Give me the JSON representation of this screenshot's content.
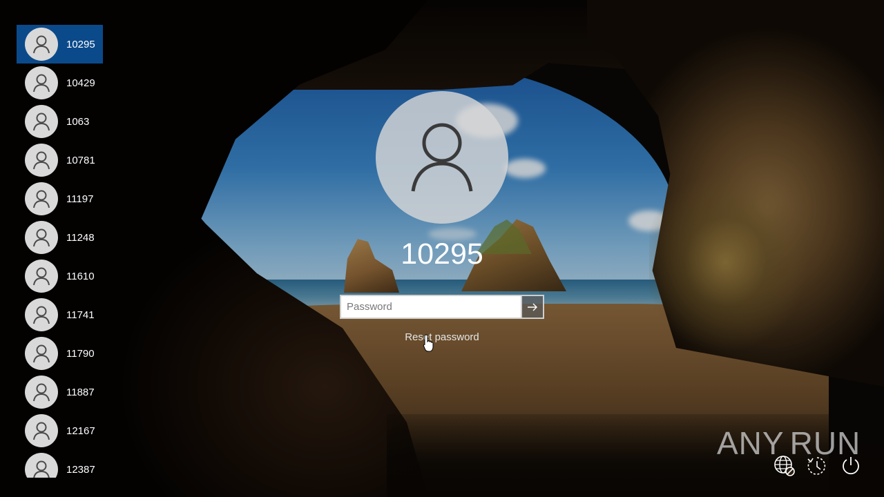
{
  "login": {
    "selected_user": "10295",
    "password_placeholder": "Password",
    "reset_password_label": "Reset password"
  },
  "users": [
    {
      "name": "10295",
      "selected": true
    },
    {
      "name": "10429",
      "selected": false
    },
    {
      "name": "1063",
      "selected": false
    },
    {
      "name": "10781",
      "selected": false
    },
    {
      "name": "11197",
      "selected": false
    },
    {
      "name": "11248",
      "selected": false
    },
    {
      "name": "11610",
      "selected": false
    },
    {
      "name": "11741",
      "selected": false
    },
    {
      "name": "11790",
      "selected": false
    },
    {
      "name": "11887",
      "selected": false
    },
    {
      "name": "12167",
      "selected": false
    },
    {
      "name": "12387",
      "selected": false
    }
  ],
  "watermark": {
    "left_text": "ANY",
    "right_text": "RUN"
  },
  "icons": {
    "user": "user-icon",
    "submit": "arrow-right-icon",
    "network": "network-icon",
    "accessibility": "ease-of-access-icon",
    "power": "power-icon"
  },
  "colors": {
    "selected_user_bg": "#0b4a8a",
    "avatar_bg": "#d9d9d9"
  }
}
